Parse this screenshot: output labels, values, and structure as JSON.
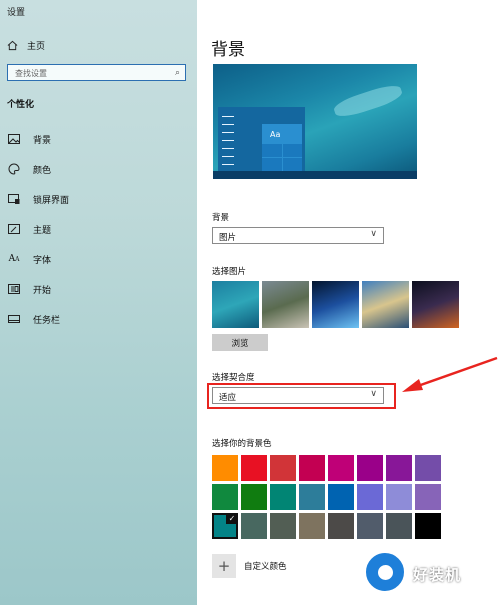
{
  "window": {
    "title": "设置"
  },
  "sidebar": {
    "home_label": "主页",
    "search_placeholder": "查找设置",
    "section_title": "个性化",
    "items": [
      {
        "label": "背景",
        "icon": "picture-icon"
      },
      {
        "label": "颜色",
        "icon": "palette-icon"
      },
      {
        "label": "锁屏界面",
        "icon": "lock-screen-icon"
      },
      {
        "label": "主题",
        "icon": "theme-icon"
      },
      {
        "label": "字体",
        "icon": "font-icon"
      },
      {
        "label": "开始",
        "icon": "start-icon"
      },
      {
        "label": "任务栏",
        "icon": "taskbar-icon"
      }
    ]
  },
  "main": {
    "title": "背景",
    "preview": {
      "tile_text": "Aa"
    },
    "background_label": "背景",
    "background_value": "图片",
    "choose_picture_label": "选择图片",
    "browse_label": "浏览",
    "fit_label": "选择契合度",
    "fit_value": "适应",
    "color_label": "选择你的背景色",
    "custom_color_label": "自定义颜色"
  },
  "thumbnails": [
    {
      "colors": [
        "#1c7fa0",
        "#2ea6b8",
        "#0d5a7a"
      ]
    },
    {
      "colors": [
        "#7b8a93",
        "#5a6b4f",
        "#c9c3b5"
      ]
    },
    {
      "colors": [
        "#03152e",
        "#1c4f9e",
        "#6ec3f3"
      ]
    },
    {
      "colors": [
        "#3f7fbf",
        "#d8c58d",
        "#2a4f75"
      ]
    },
    {
      "colors": [
        "#0c0f1e",
        "#3a2b4f",
        "#d06420"
      ]
    }
  ],
  "swatches": [
    "#FF8C00",
    "#E81123",
    "#D13438",
    "#C30052",
    "#BF0077",
    "#9A0089",
    "#881798",
    "#744DA9",
    "#10893E",
    "#107C10",
    "#018574",
    "#2D7D9A",
    "#0063B1",
    "#6B69D6",
    "#8E8CD8",
    "#8764B8",
    "#038387",
    "#486860",
    "#525E54",
    "#7E735F",
    "#4C4A48",
    "#515C6B",
    "#4A5459",
    "#000000"
  ],
  "selected_swatch": 16,
  "watermark": {
    "text": "好装机"
  }
}
